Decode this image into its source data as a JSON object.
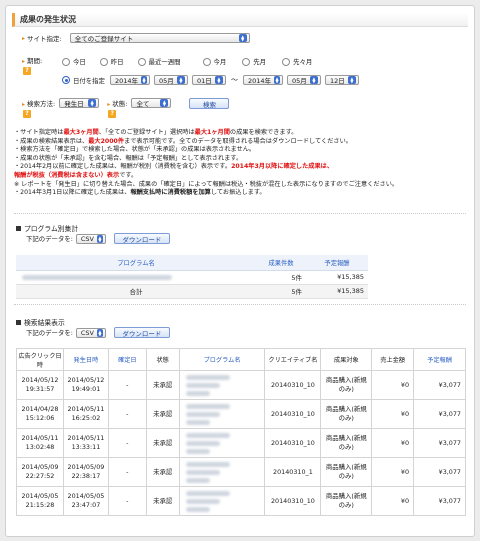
{
  "page_title": "成果の発生状況",
  "filters": {
    "site_label": "サイト指定:",
    "site_value": "全てのご登録サイト",
    "period_label": "期間:",
    "period_options": [
      "今日",
      "昨日",
      "最近一週間",
      "今月",
      "先月",
      "先々月"
    ],
    "date_option": "日付を指定",
    "start_year": "2014年",
    "start_month": "05月",
    "start_day": "01日",
    "tilde": "〜",
    "end_year": "2014年",
    "end_month": "05月",
    "end_day": "12日",
    "search_method_label": "検索方法:",
    "search_method_value": "発生日",
    "status_label": "状態:",
    "status_value": "全て",
    "search_button": "検索",
    "help_icon": "?"
  },
  "notes": [
    {
      "a": "・サイト指定時は",
      "r": "最大3ヶ月間",
      "b": "、「全てのご登録サイト」選択時は",
      "r2": "最大1ヶ月間",
      "c": "の成果を検索できます。"
    },
    {
      "a": "・成果の検索結果表示は、",
      "r": "最大2000件",
      "b": "まで表示可能です。全てのデータを取得される場合はダウンロードしてください。"
    },
    {
      "a": "・検索方法を「確定日」で検索した場合、状態が「未承認」の成果は表示されません。"
    },
    {
      "a": "・成果の状態が「未承認」を含む場合、報酬は「予定報酬」として表示されます。"
    },
    {
      "a": "・2014年2月以前に確定した成果は、報酬が税別（消費税を含む）表示です。",
      "r": "2014年3月以降に確定した成果は、"
    },
    {
      "r": "報酬が税抜（消費税は含まない）表示",
      "b": "です。"
    },
    {
      "a": "※ レポートを「発生日」に切り替えた場合、成果の「確定日」によって報酬は税込・税抜が混在した表示になりますのでご注意ください。"
    },
    {
      "a": "・2014年3月1日以降に確定した成果は、",
      "bold": "報酬支払時に消費税額を加算",
      "b": "してお振込します。"
    }
  ],
  "program_section": {
    "title": "プログラム別集計",
    "download_label": "下記のデータを:",
    "format_value": "CSV",
    "download_button": "ダウンロード",
    "columns": [
      "プログラム名",
      "成果件数",
      "予定報酬"
    ],
    "rows": [
      {
        "count": "5件",
        "reward": "¥15,385"
      }
    ],
    "total": {
      "label": "合計",
      "count": "5件",
      "reward": "¥15,385"
    }
  },
  "result_section": {
    "title": "検索結果表示",
    "download_label": "下記のデータを:",
    "format_value": "CSV",
    "download_button": "ダウンロード",
    "columns": [
      "広告クリック日時",
      "発生日時",
      "確定日",
      "状態",
      "プログラム名",
      "クリエイティブ名",
      "成果対象",
      "売上金額",
      "予定報酬"
    ],
    "rows": [
      {
        "click": [
          "2014/05/12",
          "19:31:57"
        ],
        "occur": [
          "2014/05/12",
          "19:49:01"
        ],
        "confirm": "-",
        "status": "未承認",
        "creative": "20140310_10",
        "target": [
          "商品購入(新規",
          "のみ)"
        ],
        "sales": "¥0",
        "reward": "¥3,077"
      },
      {
        "click": [
          "2014/04/28",
          "15:12:06"
        ],
        "occur": [
          "2014/05/11",
          "16:25:02"
        ],
        "confirm": "-",
        "status": "未承認",
        "creative": "20140310_10",
        "target": [
          "商品購入(新規",
          "のみ)"
        ],
        "sales": "¥0",
        "reward": "¥3,077"
      },
      {
        "click": [
          "2014/05/11",
          "13:02:48"
        ],
        "occur": [
          "2014/05/11",
          "13:33:11"
        ],
        "confirm": "-",
        "status": "未承認",
        "creative": "20140310_10",
        "target": [
          "商品購入(新規",
          "のみ)"
        ],
        "sales": "¥0",
        "reward": "¥3,077"
      },
      {
        "click": [
          "2014/05/09",
          "22:27:52"
        ],
        "occur": [
          "2014/05/09",
          "22:38:17"
        ],
        "confirm": "-",
        "status": "未承認",
        "creative": "20140310_1",
        "target": [
          "商品購入(新規",
          "のみ)"
        ],
        "sales": "¥0",
        "reward": "¥3,077"
      },
      {
        "click": [
          "2014/05/05",
          "21:15:28"
        ],
        "occur": [
          "2014/05/05",
          "23:47:07"
        ],
        "confirm": "-",
        "status": "未承認",
        "creative": "20140310_10",
        "target": [
          "商品購入(新規",
          "のみ)"
        ],
        "sales": "¥0",
        "reward": "¥3,077"
      }
    ]
  }
}
